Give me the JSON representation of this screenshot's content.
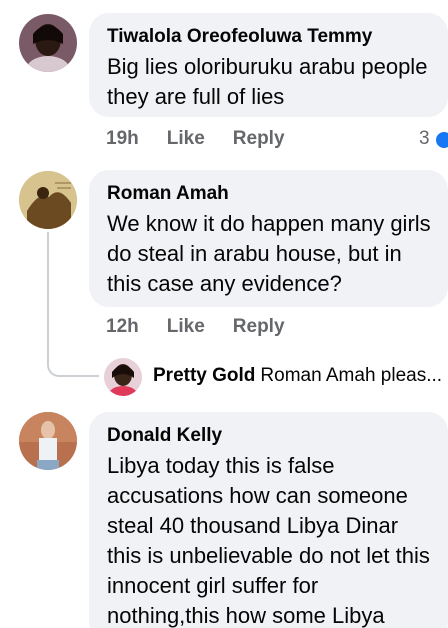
{
  "comments": [
    {
      "author": "Tiwalola Oreofeoluwa Temmy",
      "text": "Big lies oloriburuku arabu people they are full of lies",
      "time": "19h",
      "like": "Like",
      "reply": "Reply",
      "reaction_count": "3"
    },
    {
      "author": "Roman Amah",
      "text": "We know it do happen many girls do steal in arabu house, but in this case any evidence?",
      "time": "12h",
      "like": "Like",
      "reply": "Reply"
    },
    {
      "author": "Donald Kelly",
      "text": "Libya today this is false accusations how can someone steal 40 thousand Libya Dinar this is unbelievable do not let this innocent girl suffer for nothing,this how some Libya"
    }
  ],
  "reply_preview": {
    "author": "Pretty Gold",
    "text": "Roman Amah pleas..."
  },
  "colors": {
    "bubble": "#f0f2f5",
    "meta": "#65676b",
    "accent": "#1877f2"
  }
}
